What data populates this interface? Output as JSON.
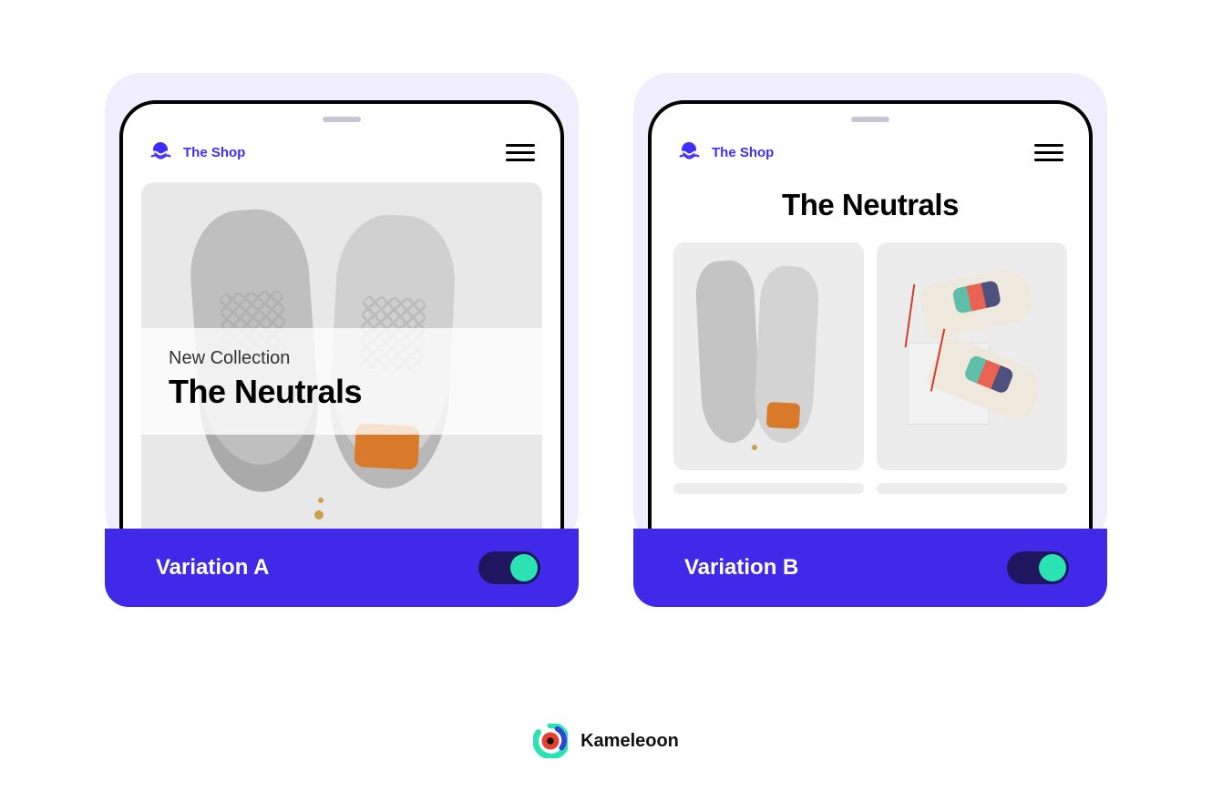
{
  "brand": {
    "name": "The Shop"
  },
  "variationA": {
    "label": "Variation  A",
    "hero_subtitle": "New Collection",
    "hero_title": "The Neutrals"
  },
  "variationB": {
    "label": "Variation  B",
    "title": "The Neutrals"
  },
  "footer": {
    "name": "Kameleoon"
  }
}
